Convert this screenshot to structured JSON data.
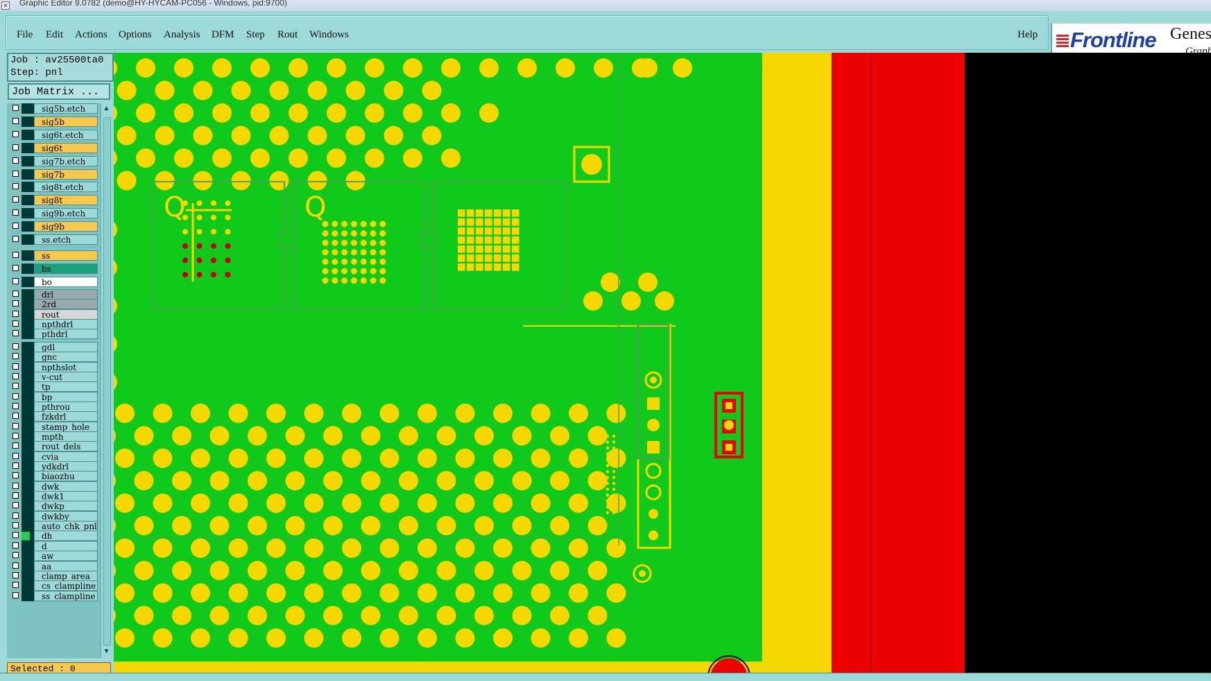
{
  "window": {
    "title": "Graphic Editor 9.0782 (demo@HY-HYCAM-PC056 - Windows, pid:9700)"
  },
  "menu": {
    "items": [
      "File",
      "Edit",
      "Actions",
      "Options",
      "Analysis",
      "DFM",
      "Step",
      "Rout",
      "Windows"
    ],
    "help": "Help"
  },
  "brand": {
    "frontline": "Frontline",
    "genesis": "Genes",
    "graph": "Graph"
  },
  "job": {
    "job_line": "Job : av25500ta0",
    "step_line": "Step: pnl",
    "matrix_button": "Job Matrix ..."
  },
  "layers": [
    {
      "name": "sig5b.etch",
      "color": "#9ed9d9"
    },
    {
      "name": "sig5b",
      "color": "#f6c84e"
    },
    {
      "name": "sig6t.etch",
      "color": "#9ed9d9"
    },
    {
      "name": "sig6t",
      "color": "#f6c84e"
    },
    {
      "name": "sig7b.etch",
      "color": "#9ed9d9"
    },
    {
      "name": "sig7b",
      "color": "#f6c84e"
    },
    {
      "name": "sig8t.etch",
      "color": "#9ed9d9"
    },
    {
      "name": "sig8t",
      "color": "#f6c84e"
    },
    {
      "name": "sig9b.etch",
      "color": "#9ed9d9"
    },
    {
      "name": "sig9b",
      "color": "#f6c84e"
    },
    {
      "name": "ss.etch",
      "color": "#9ed9d9"
    },
    {
      "name": "ss",
      "color": "#f6c84e"
    },
    {
      "name": "bs",
      "color": "#1aa07a"
    },
    {
      "name": "bo",
      "color": "#ffffff"
    },
    {
      "name": "drl",
      "color": "#9aa9ad"
    },
    {
      "name": "2rd",
      "color": "#9aa9ad"
    },
    {
      "name": "rout",
      "color": "#d7d7d7"
    },
    {
      "name": "npthdrl",
      "color": "#9ed9d9"
    },
    {
      "name": "pthdrl",
      "color": "#9ed9d9"
    },
    {
      "name": "gdl",
      "color": "#9ed9d9"
    },
    {
      "name": "gnc",
      "color": "#9ed9d9"
    },
    {
      "name": "npthslot",
      "color": "#9ed9d9"
    },
    {
      "name": "v-cut",
      "color": "#9ed9d9"
    },
    {
      "name": "tp",
      "color": "#9ed9d9"
    },
    {
      "name": "bp",
      "color": "#9ed9d9"
    },
    {
      "name": "pthrou",
      "color": "#9ed9d9"
    },
    {
      "name": "fzkdrl",
      "color": "#9ed9d9"
    },
    {
      "name": "stamp_hole",
      "color": "#9ed9d9"
    },
    {
      "name": "mpth",
      "color": "#9ed9d9"
    },
    {
      "name": "rout_dels",
      "color": "#9ed9d9"
    },
    {
      "name": "cvia",
      "color": "#9ed9d9"
    },
    {
      "name": "ydkdrl",
      "color": "#9ed9d9"
    },
    {
      "name": "biaozhu",
      "color": "#9ed9d9"
    },
    {
      "name": "dwk",
      "color": "#9ed9d9"
    },
    {
      "name": "dwk1",
      "color": "#9ed9d9"
    },
    {
      "name": "dwkp",
      "color": "#9ed9d9"
    },
    {
      "name": "dwkby",
      "color": "#9ed9d9"
    },
    {
      "name": "auto_chk_pnl",
      "color": "#9ed9d9"
    },
    {
      "name": "dh",
      "color": "#9ed9d9",
      "active": true
    },
    {
      "name": "d",
      "color": "#9ed9d9"
    },
    {
      "name": "aw",
      "color": "#9ed9d9"
    },
    {
      "name": "aa",
      "color": "#9ed9d9"
    },
    {
      "name": "clamp_area",
      "color": "#9ed9d9"
    },
    {
      "name": "cs_clampline",
      "color": "#9ed9d9"
    },
    {
      "name": "ss_clampline",
      "color": "#9ed9d9"
    }
  ],
  "status": {
    "selected": "Selected : 0"
  },
  "board": {
    "green": "#11c91a",
    "yellow": "#f4d800",
    "red": "#ee0000",
    "outline": "#49a64d",
    "drill_red": "#c40010",
    "pad_letter": "Q"
  }
}
